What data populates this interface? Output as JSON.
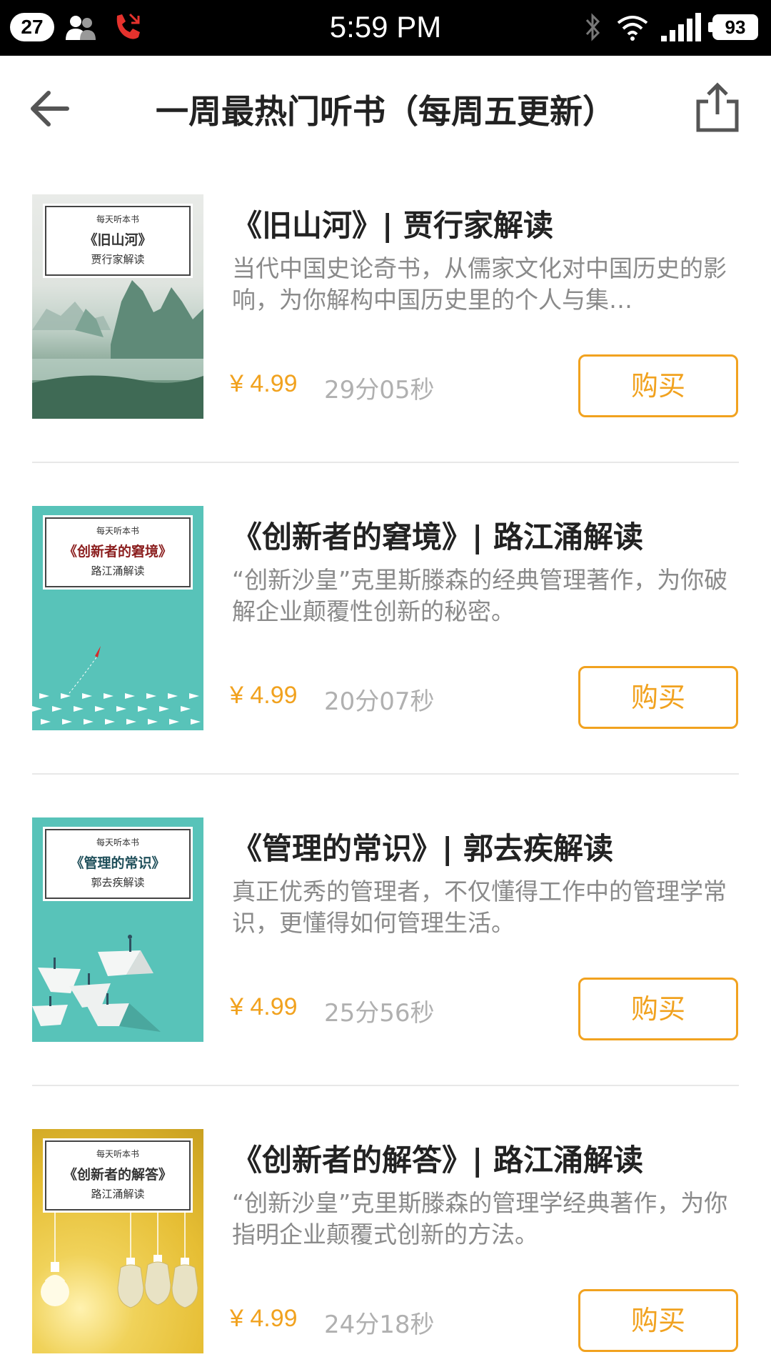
{
  "status_bar": {
    "notification_count": "27",
    "time": "5:59 PM",
    "battery": "93"
  },
  "header": {
    "title": "一周最热门听书（每周五更新）"
  },
  "books": [
    {
      "cover": {
        "series": "每天听本书",
        "title": "《旧山河》",
        "author": "贾行家解读",
        "theme": "ink-landscape"
      },
      "title": "《旧山河》| 贾行家解读",
      "description": "当代中国史论奇书，从儒家文化对中国历史的影响，为你解构中国历史里的个人与集…",
      "price": "¥ 4.99",
      "duration": "29分05秒",
      "buy_label": "购买"
    },
    {
      "cover": {
        "series": "每天听本书",
        "title": "《创新者的窘境》",
        "author": "路江涌解读",
        "theme": "paper-planes"
      },
      "title": "《创新者的窘境》| 路江涌解读",
      "description": "“创新沙皇”克里斯滕森的经典管理著作，为你破解企业颠覆性创新的秘密。",
      "price": "¥ 4.99",
      "duration": "20分07秒",
      "buy_label": "购买"
    },
    {
      "cover": {
        "series": "每天听本书",
        "title": "《管理的常识》",
        "author": "郭去疾解读",
        "theme": "paper-boats"
      },
      "title": "《管理的常识》| 郭去疾解读",
      "description": "真正优秀的管理者，不仅懂得工作中的管理学常识，更懂得如何管理生活。",
      "price": "¥ 4.99",
      "duration": "25分56秒",
      "buy_label": "购买"
    },
    {
      "cover": {
        "series": "每天听本书",
        "title": "《创新者的解答》",
        "author": "路江涌解读",
        "theme": "light-bulbs"
      },
      "title": "《创新者的解答》| 路江涌解读",
      "description": "“创新沙皇”克里斯滕森的管理学经典著作，为你指明企业颠覆式创新的方法。",
      "price": "¥ 4.99",
      "duration": "24分18秒",
      "buy_label": "购买"
    }
  ],
  "colors": {
    "accent": "#f1a21f",
    "missed_call": "#e5322d",
    "cover_teal": "#58c3b9",
    "cover_yellow": "#e9c33a"
  }
}
